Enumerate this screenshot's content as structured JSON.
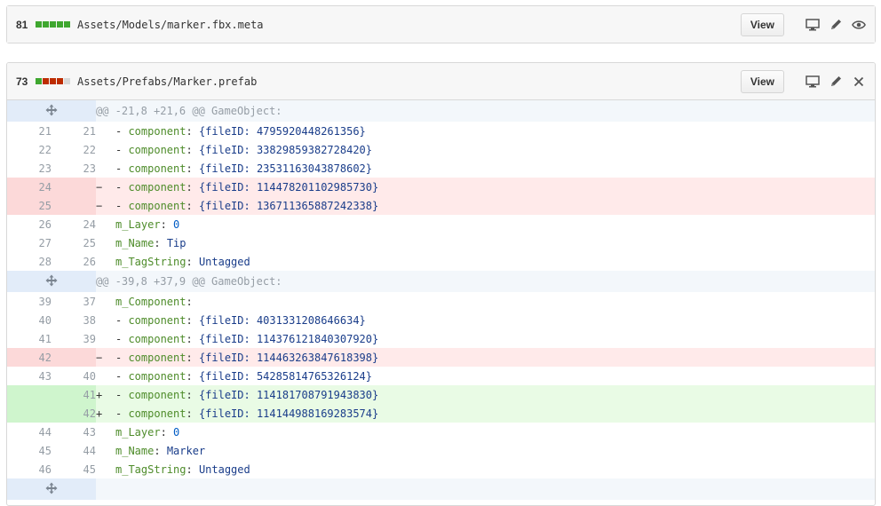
{
  "colors": {
    "add": "#3fa72f",
    "del": "#bd2c00",
    "neutral": "#d8d8d8"
  },
  "file1": {
    "count": "81",
    "blocks": [
      "add",
      "add",
      "add",
      "add",
      "add"
    ],
    "path": "Assets/Models/marker.fbx.meta",
    "view_label": "View",
    "icons": [
      "desktop-icon",
      "pencil-icon",
      "eye-icon"
    ]
  },
  "file2": {
    "count": "73",
    "blocks": [
      "add",
      "del",
      "del",
      "del",
      "neutral"
    ],
    "path": "Assets/Prefabs/Marker.prefab",
    "view_label": "View",
    "icons": [
      "desktop-icon",
      "pencil-icon",
      "close-icon"
    ],
    "lines": [
      {
        "type": "hunk",
        "text": "@@ -21,8 +21,6 @@ GameObject:"
      },
      {
        "type": "ctx",
        "old": "21",
        "new": "21",
        "sign": "",
        "parts": [
          [
            "p",
            "- "
          ],
          [
            "k",
            "component"
          ],
          [
            "p",
            ": "
          ],
          [
            "v",
            "{fileID: 4795920448261356}"
          ]
        ]
      },
      {
        "type": "ctx",
        "old": "22",
        "new": "22",
        "sign": "",
        "parts": [
          [
            "p",
            "- "
          ],
          [
            "k",
            "component"
          ],
          [
            "p",
            ": "
          ],
          [
            "v",
            "{fileID: 33829859382728420}"
          ]
        ]
      },
      {
        "type": "ctx",
        "old": "23",
        "new": "23",
        "sign": "",
        "parts": [
          [
            "p",
            "- "
          ],
          [
            "k",
            "component"
          ],
          [
            "p",
            ": "
          ],
          [
            "v",
            "{fileID: 23531163043878602}"
          ]
        ]
      },
      {
        "type": "del",
        "old": "24",
        "new": "",
        "sign": "−",
        "parts": [
          [
            "p",
            "- "
          ],
          [
            "k",
            "component"
          ],
          [
            "p",
            ": "
          ],
          [
            "v",
            "{fileID: 114478201102985730}"
          ]
        ]
      },
      {
        "type": "del",
        "old": "25",
        "new": "",
        "sign": "−",
        "parts": [
          [
            "p",
            "- "
          ],
          [
            "k",
            "component"
          ],
          [
            "p",
            ": "
          ],
          [
            "v",
            "{fileID: 136711365887242338}"
          ]
        ]
      },
      {
        "type": "ctx",
        "old": "26",
        "new": "24",
        "sign": "",
        "parts": [
          [
            "k",
            "m_Layer"
          ],
          [
            "p",
            ": "
          ],
          [
            "n",
            "0"
          ]
        ]
      },
      {
        "type": "ctx",
        "old": "27",
        "new": "25",
        "sign": "",
        "parts": [
          [
            "k",
            "m_Name"
          ],
          [
            "p",
            ": "
          ],
          [
            "v",
            "Tip"
          ]
        ]
      },
      {
        "type": "ctx",
        "old": "28",
        "new": "26",
        "sign": "",
        "parts": [
          [
            "k",
            "m_TagString"
          ],
          [
            "p",
            ": "
          ],
          [
            "v",
            "Untagged"
          ]
        ]
      },
      {
        "type": "hunk",
        "text": "@@ -39,8 +37,9 @@ GameObject:"
      },
      {
        "type": "ctx",
        "old": "39",
        "new": "37",
        "sign": "",
        "parts": [
          [
            "k",
            "m_Component"
          ],
          [
            "p",
            ":"
          ]
        ]
      },
      {
        "type": "ctx",
        "old": "40",
        "new": "38",
        "sign": "",
        "parts": [
          [
            "p",
            "- "
          ],
          [
            "k",
            "component"
          ],
          [
            "p",
            ": "
          ],
          [
            "v",
            "{fileID: 4031331208646634}"
          ]
        ]
      },
      {
        "type": "ctx",
        "old": "41",
        "new": "39",
        "sign": "",
        "parts": [
          [
            "p",
            "- "
          ],
          [
            "k",
            "component"
          ],
          [
            "p",
            ": "
          ],
          [
            "v",
            "{fileID: 114376121840307920}"
          ]
        ]
      },
      {
        "type": "del",
        "old": "42",
        "new": "",
        "sign": "−",
        "parts": [
          [
            "p",
            "- "
          ],
          [
            "k",
            "component"
          ],
          [
            "p",
            ": "
          ],
          [
            "v",
            "{fileID: 114463263847618398}"
          ]
        ]
      },
      {
        "type": "ctx",
        "old": "43",
        "new": "40",
        "sign": "",
        "parts": [
          [
            "p",
            "- "
          ],
          [
            "k",
            "component"
          ],
          [
            "p",
            ": "
          ],
          [
            "v",
            "{fileID: 54285814765326124}"
          ]
        ]
      },
      {
        "type": "add",
        "old": "",
        "new": "41",
        "sign": "+",
        "parts": [
          [
            "p",
            "- "
          ],
          [
            "k",
            "component"
          ],
          [
            "p",
            ": "
          ],
          [
            "v",
            "{fileID: 114181708791943830}"
          ]
        ]
      },
      {
        "type": "add",
        "old": "",
        "new": "42",
        "sign": "+",
        "parts": [
          [
            "p",
            "- "
          ],
          [
            "k",
            "component"
          ],
          [
            "p",
            ": "
          ],
          [
            "v",
            "{fileID: 114144988169283574}"
          ]
        ]
      },
      {
        "type": "ctx",
        "old": "44",
        "new": "43",
        "sign": "",
        "parts": [
          [
            "k",
            "m_Layer"
          ],
          [
            "p",
            ": "
          ],
          [
            "n",
            "0"
          ]
        ]
      },
      {
        "type": "ctx",
        "old": "45",
        "new": "44",
        "sign": "",
        "parts": [
          [
            "k",
            "m_Name"
          ],
          [
            "p",
            ": "
          ],
          [
            "v",
            "Marker"
          ]
        ]
      },
      {
        "type": "ctx",
        "old": "46",
        "new": "45",
        "sign": "",
        "parts": [
          [
            "k",
            "m_TagString"
          ],
          [
            "p",
            ": "
          ],
          [
            "v",
            "Untagged"
          ]
        ]
      },
      {
        "type": "hunk",
        "text": ""
      }
    ]
  }
}
